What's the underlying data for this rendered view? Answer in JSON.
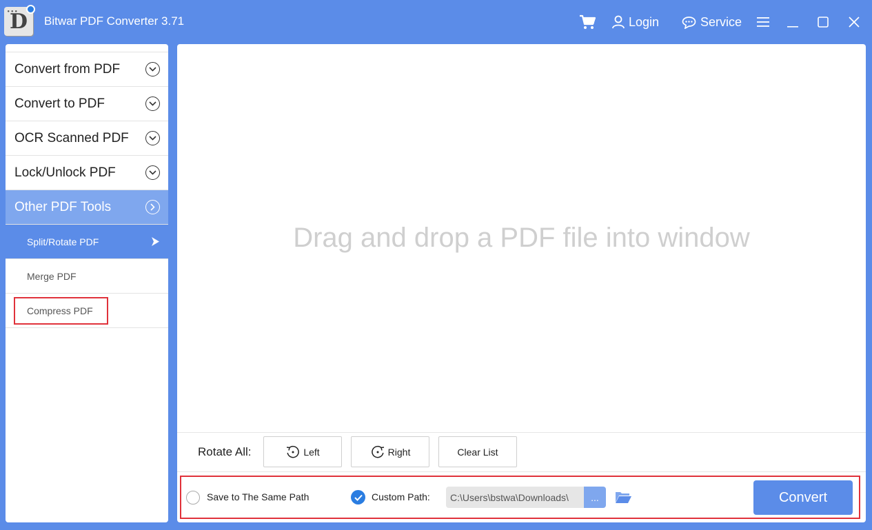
{
  "app": {
    "logo_letter": "D",
    "title": "Bitwar PDF Converter 3.71"
  },
  "header": {
    "cart_icon": "cart-icon",
    "login_label": "Login",
    "service_label": "Service"
  },
  "sidebar": {
    "categories": [
      {
        "label": "Convert from PDF",
        "icon": "chevron-down-circle-icon"
      },
      {
        "label": "Convert to PDF",
        "icon": "chevron-down-circle-icon"
      },
      {
        "label": "OCR Scanned PDF",
        "icon": "chevron-down-circle-icon"
      },
      {
        "label": "Lock/Unlock PDF",
        "icon": "chevron-down-circle-icon"
      },
      {
        "label": "Other PDF Tools",
        "icon": "chevron-right-circle-icon",
        "active": true
      }
    ],
    "subitems": [
      {
        "label": "Split/Rotate PDF",
        "active": true
      },
      {
        "label": "Merge PDF"
      },
      {
        "label": "Compress PDF",
        "highlighted": true
      }
    ]
  },
  "main": {
    "drop_hint": "Drag and drop a PDF file into window",
    "rotate_all_label": "Rotate All:",
    "left_label": "Left",
    "right_label": "Right",
    "clear_list_label": "Clear List",
    "save_same_path_label": "Save to The Same Path",
    "custom_path_label": "Custom Path:",
    "custom_path_value": "C:\\Users\\bstwa\\Downloads\\",
    "browse_label": "...",
    "convert_label": "Convert"
  },
  "colors": {
    "accent": "#5b8ce8",
    "active_category": "#7fa7ee",
    "highlight": "#e0313a"
  }
}
